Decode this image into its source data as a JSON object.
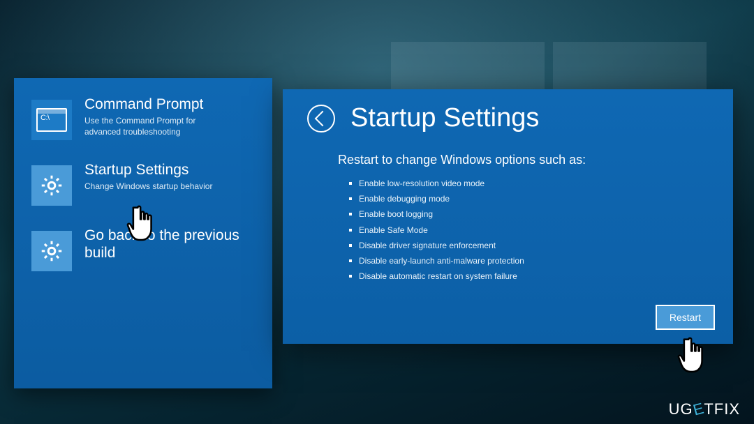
{
  "left_panel": {
    "options": [
      {
        "title": "Command Prompt",
        "desc": "Use the Command Prompt for advanced troubleshooting"
      },
      {
        "title": "Startup Settings",
        "desc": "Change Windows startup behavior"
      },
      {
        "title": "Go back to the previous build",
        "desc": ""
      }
    ]
  },
  "right_panel": {
    "title": "Startup Settings",
    "subtitle": "Restart to change Windows options such as:",
    "items": [
      "Enable low-resolution video mode",
      "Enable debugging mode",
      "Enable boot logging",
      "Enable Safe Mode",
      "Disable driver signature enforcement",
      "Disable early-launch anti-malware protection",
      "Disable automatic restart on system failure"
    ],
    "restart_label": "Restart"
  },
  "watermark": {
    "pre": "UG",
    "e": "E",
    "post": "TFIX"
  }
}
